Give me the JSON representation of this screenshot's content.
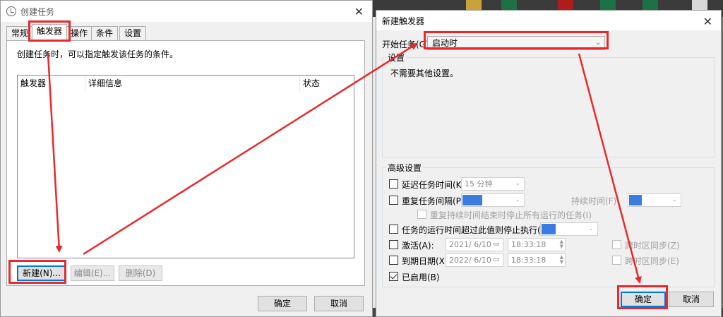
{
  "left_dialog": {
    "title": "创建任务",
    "tabs": [
      "常规",
      "触发器",
      "操作",
      "条件",
      "设置"
    ],
    "description": "创建任务时，可以指定触发该任务的条件。",
    "columns": [
      "触发器",
      "详细信息",
      "状态"
    ],
    "buttons": {
      "new": "新建(N)...",
      "edit": "编辑(E)...",
      "delete": "删除(D)",
      "ok": "确定",
      "cancel": "取消"
    }
  },
  "right_dialog": {
    "title": "新建触发器",
    "begin_label": "开始任务(G):",
    "begin_value": "启动时",
    "settings_title": "设置",
    "settings_text": "不需要其他设置。",
    "advanced_title": "高级设置",
    "delay_label": "延迟任务时间(K):",
    "delay_value": "15 分钟",
    "repeat_label": "重复任务间隔(P):",
    "duration_label": "持续时间(F):",
    "stop_all_label": "重复持续时间结束时停止所有运行的任务(I)",
    "stop_if_longer_label": "任务的运行时间超过此值则停止执行(L):",
    "activate_label": "激活(A):",
    "activate_date": "2021/ 6/10",
    "activate_time": "18:33:18",
    "expire_label": "到期日期(X):",
    "expire_date": "2022/ 6/10",
    "expire_time": "18:33:18",
    "sync_tz_label_1": "跨时区同步(Z)",
    "sync_tz_label_2": "跨时区同步(E)",
    "enabled_label": "已启用(B)",
    "ok": "确定",
    "cancel": "取消"
  },
  "colors": {
    "highlight": "#e8292b",
    "accent": "#0078d7"
  },
  "icons": [
    "clock-icon",
    "close-icon",
    "chevron-down-icon",
    "checkbox-icon"
  ]
}
